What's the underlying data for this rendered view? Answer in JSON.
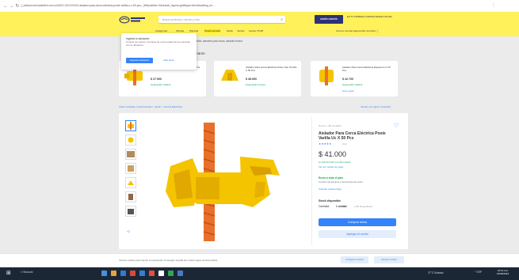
{
  "browser": {
    "nav_icons": "←  →  ↻  ⌂",
    "url": "articulo.mercadolibre.com.co/MCO-XXXXXXXX-aislador-para-cerca-electrica-poste-varilla-u-x-50-pcs-_JM#position=2&search_layout=grid&type=item&tracking_id=..."
  },
  "header": {
    "search_placeholder": "Buscar productos, marcas y más...",
    "promo_label": "ENVÍO GRATIS",
    "promo_text": "EN TU PRIMERA COMPRA DESDE $ 60.000",
    "nav": [
      "Categorías",
      "Ofertas",
      "Historial",
      "Supermercado",
      "Moda",
      "Vender",
      "Ayuda / PQR"
    ],
    "nav_right": "Crea tu cuenta   Ingresa   Mis compras   🛒"
  },
  "popover": {
    "title": "Ingresá tu ubicación",
    "body": "Conocé los costos y tiempos de envío reales de tus compras con tu ubicación.",
    "primary": "Ingresar ubicación",
    "secondary": "Más tarde"
  },
  "subbar": "Tus búsquedas: aislador para cerca eléctrica, aislador poste varilla, alambre para cerca, aislador tensor",
  "recommendations": {
    "title": "Quienes vieron este producto también compraron",
    "items": [
      {
        "title": "Aislador Poste Varilla Cerca Eléctrica X 25 Pcs",
        "price": "$ 27.900",
        "ship": "Llega gratis mañana",
        "link": "Envío gratis"
      },
      {
        "title": "Aislador Para Cerca Eléctrica Poste Tipo Tornillo X 50 Pcs",
        "price": "$ 38.900",
        "ship": "Llega gratis el lunes",
        "link": "Envío gratis"
      },
      {
        "title": "Aislador Para Cerca Eléctrica Esquinero X 20 Pcs",
        "price": "$ 42.700",
        "ship": "Llega gratis mañana",
        "link": "Envío gratis"
      }
    ]
  },
  "breadcrumb": "Volver al listado | Herramientas > Jardín > Cercas Eléctricas",
  "seller_links": "Vender uno igual | Compartir",
  "product": {
    "condition": "Nuevo  |  +50 vendidos",
    "title": "Aislador Para Cerca Eléctrica Poste Varilla Uc X 50 Pcs",
    "stars": "★★★★★",
    "reviews": "(12)",
    "price": "$ 41.000",
    "installments": "en 12x $ 3.417 con 0% interés",
    "payment_link": "Ver los medios de pago",
    "shipping_title": "Envío a todo el país",
    "shipping_detail": "Conoce los tiempos y las formas de envío.",
    "shipping_link": "Calcular cuándo llega",
    "stock": "Stock disponible",
    "qty_label": "Cantidad:",
    "qty_value": "1 unidad",
    "qty_available": "(+50 disponibles)",
    "buy": "Comprar ahora",
    "cart": "Agregar al carrito",
    "more_images": "+2"
  },
  "cookies": {
    "text": "Usamos cookies para mejorar tu experiencia. Al navegar, aceptás las cookies según nuestra política.",
    "config": "Configurar cookies",
    "accept": "Aceptar cookies"
  },
  "taskbar": {
    "start_icon": "windows-logo",
    "search": "⌕ Buscar",
    "weather": "27°C Soleado",
    "tray": "⌃ ESP",
    "time": "10:14 a.m.",
    "date": "15/06/2023"
  },
  "colors": {
    "ml_yellow": "#fff159",
    "ml_blue": "#3483fa",
    "ml_green": "#00a650",
    "product_yellow": "#f5c400",
    "rod_orange": "#e8702a"
  }
}
